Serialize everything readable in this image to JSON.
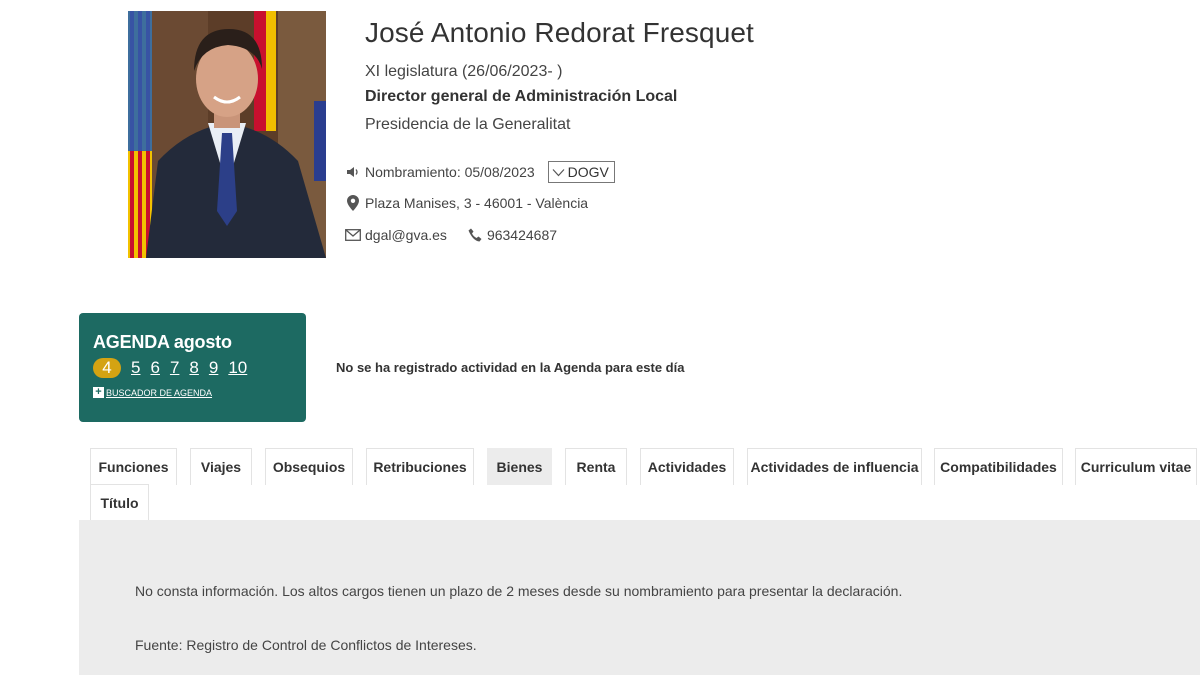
{
  "profile": {
    "name": "José Antonio Redorat Fresquet",
    "legislatura": "XI legislatura (26/06/2023- )",
    "position": "Director general de Administración Local",
    "department": "Presidencia de la Generalitat",
    "nombramiento": "Nombramiento: 05/08/2023",
    "dogv_label": "DOGV",
    "address": "Plaza Manises, 3 - 46001 - València",
    "email": "dgal@gva.es",
    "phone": "963424687"
  },
  "agenda": {
    "title": "AGENDA agosto",
    "days": [
      "4",
      "5",
      "6",
      "7",
      "8",
      "9",
      "10"
    ],
    "active_day": "4",
    "search_label": "BUSCADOR DE AGENDA",
    "no_activity": "No se ha registrado actividad en la Agenda para este día",
    "color": "#1d6a62",
    "active_color": "#d4a312"
  },
  "tabs": {
    "active": "Bienes",
    "items": [
      "Funciones",
      "Viajes",
      "Obsequios",
      "Retribuciones",
      "Bienes",
      "Renta",
      "Actividades",
      "Actividades de influencia",
      "Compatibilidades",
      "Curriculum vitae",
      "Título"
    ]
  },
  "content": {
    "paragraph1": "No consta información. Los altos cargos tienen un plazo de 2 meses desde su nombramiento para presentar la declaración.",
    "paragraph2": "Fuente: Registro de Control de Conflictos de Intereses."
  }
}
